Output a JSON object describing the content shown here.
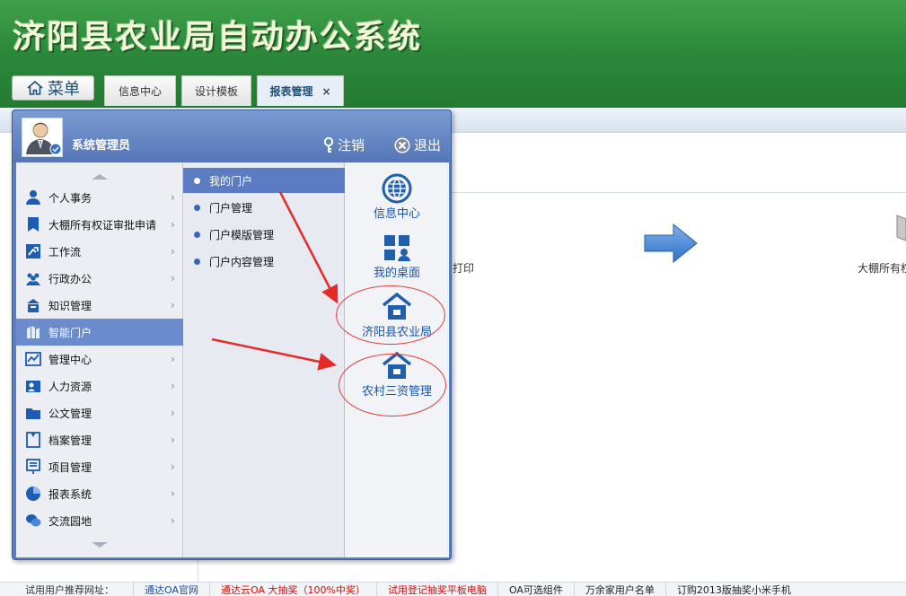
{
  "header": {
    "app_title": "济阳县农业局自动办公系统",
    "menu_label": "菜单",
    "tabs": [
      {
        "label": "信息中心"
      },
      {
        "label": "设计模板"
      },
      {
        "label": "报表管理",
        "close": "×"
      }
    ]
  },
  "background": {
    "print_text": "打印",
    "right_text": "大棚所有权"
  },
  "menu_popup": {
    "username": "系统管理员",
    "logout_label": "注销",
    "exit_label": "退出",
    "main_items": [
      {
        "label": "个人事务",
        "icon": "person-icon"
      },
      {
        "label": "大棚所有权证审批申请",
        "icon": "document-icon"
      },
      {
        "label": "工作流",
        "icon": "workflow-icon"
      },
      {
        "label": "行政办公",
        "icon": "people-icon"
      },
      {
        "label": "知识管理",
        "icon": "knowledge-icon"
      },
      {
        "label": "智能门户",
        "icon": "portal-icon"
      },
      {
        "label": "管理中心",
        "icon": "chart-icon"
      },
      {
        "label": "人力资源",
        "icon": "hr-icon"
      },
      {
        "label": "公文管理",
        "icon": "folder-icon"
      },
      {
        "label": "档案管理",
        "icon": "archive-icon"
      },
      {
        "label": "项目管理",
        "icon": "project-icon"
      },
      {
        "label": "报表系统",
        "icon": "pie-icon"
      },
      {
        "label": "交流园地",
        "icon": "chat-icon"
      }
    ],
    "selected_main": "智能门户",
    "sub_items": [
      {
        "label": "我的门户"
      },
      {
        "label": "门户管理"
      },
      {
        "label": "门户模版管理"
      },
      {
        "label": "门户内容管理"
      }
    ],
    "quick_items": [
      {
        "label": "信息中心",
        "icon": "globe-icon"
      },
      {
        "label": "我的桌面",
        "icon": "desktop-icon"
      },
      {
        "label": "济阳县农业局",
        "icon": "house-icon"
      },
      {
        "label": "农村三资管理",
        "icon": "house-icon"
      }
    ]
  },
  "footer": {
    "label": "试用用户推荐网址：",
    "links": [
      {
        "text": "通达OA官网",
        "color": "#1a4fa0"
      },
      {
        "text": "通达云OA 大抽奖（100%中奖）",
        "color": "#cc1111"
      },
      {
        "text": "试用登记抽奖平板电脑",
        "color": "#cc1111"
      },
      {
        "text": "OA可选组件",
        "color": "#333333"
      },
      {
        "text": "万余家用户名单",
        "color": "#333333"
      },
      {
        "text": "订购2013版抽奖小米手机",
        "color": "#333333"
      }
    ]
  }
}
